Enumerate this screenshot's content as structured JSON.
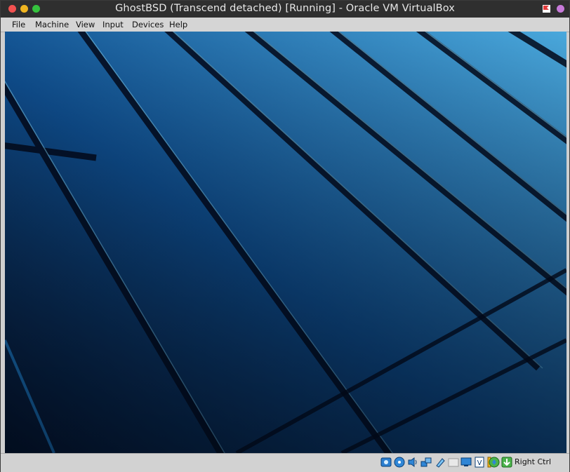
{
  "window": {
    "title": "GhostBSD (Transcend detached) [Running] - Oracle VM VirtualBox"
  },
  "menubar": {
    "items": [
      {
        "id": "file",
        "label": "File"
      },
      {
        "id": "machine",
        "label": "Machine"
      },
      {
        "id": "view",
        "label": "View"
      },
      {
        "id": "input",
        "label": "Input"
      },
      {
        "id": "devices",
        "label": "Devices"
      },
      {
        "id": "help",
        "label": "Help"
      }
    ]
  },
  "guest_screen": {
    "wallpaper": "blue diagonal wooden planks",
    "colors": {
      "dark": "#06142c",
      "mid": "#1463a5",
      "light": "#5ab7e2"
    }
  },
  "statusbar": {
    "icons": [
      "hard-disk-icon",
      "optical-drive-icon",
      "audio-icon",
      "network-icon",
      "usb-icon",
      "shared-folders-icon",
      "display-icon",
      "video-capture-icon",
      "cpu-icon",
      "mouse-integration-icon",
      "keyboard-icon"
    ],
    "host_key": "Right Ctrl"
  },
  "colors": {
    "titlebar": "#2f2f2f",
    "menubar": "#d5d5d5",
    "statusbar": "#d2d2d2",
    "close": "#f25150",
    "minimize": "#f0b520",
    "maximize": "#35c23e"
  }
}
